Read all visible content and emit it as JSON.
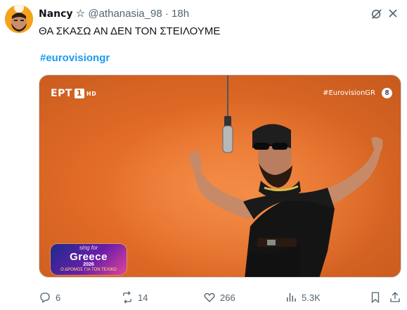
{
  "post": {
    "display_name": "Nancy",
    "badge_symbol": "☆",
    "handle": "@athanasia_98",
    "separator": "·",
    "time": "18h",
    "text": "ΘΑ ΣΚΑΣΩ ΑΝ ΔΕΝ ΤΟΝ ΣΤΕΙΛΟΥΜΕ",
    "hashtag": "#eurovisiongr"
  },
  "media": {
    "broadcaster": "ΕΡΤ",
    "channel_number": "1",
    "quality": "HD",
    "hashtag_overlay": "#EurovisionGR",
    "age_rating": "8",
    "show_logo": {
      "top": "sing for",
      "main": "Greece",
      "year": "2026",
      "subtitle": "Ο ΔΡΟΜΟΣ ΓΙΑ ΤΟΝ ΤΕΛΙΚΟ"
    }
  },
  "actions": {
    "replies": "6",
    "reposts": "14",
    "likes": "266",
    "views": "5.3K"
  },
  "icons": {
    "more": "grok-icon",
    "close": "close-icon",
    "reply": "reply-icon",
    "repost": "repost-icon",
    "like": "heart-icon",
    "views": "views-icon",
    "bookmark": "bookmark-icon",
    "share": "share-icon"
  },
  "colors": {
    "accent": "#1d9bf0",
    "muted": "#536471",
    "stage_bg": "#e06a26"
  }
}
